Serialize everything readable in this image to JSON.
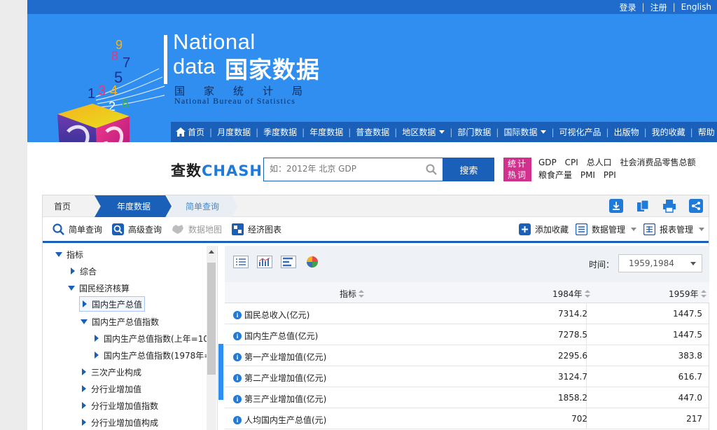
{
  "topbar": {
    "login": "登录",
    "register": "注册",
    "english": "English"
  },
  "logo": {
    "en_line1": "National",
    "en_line2": "data",
    "cn": "国家数据",
    "bureau_cn": "国家统计局",
    "bureau_en": "National Bureau of Statistics",
    "cube_digits": [
      "9",
      "8",
      "7",
      "5",
      "1",
      "3",
      "4",
      "2",
      "6"
    ]
  },
  "nav": {
    "items": [
      "首页",
      "月度数据",
      "季度数据",
      "年度数据",
      "普查数据",
      "地区数据",
      "部门数据",
      "国际数据",
      "可视化产品",
      "出版物",
      "我的收藏",
      "帮助"
    ],
    "dropdown_items": [
      "地区数据",
      "国际数据"
    ]
  },
  "search": {
    "brand_cn": "查数",
    "brand_en": "CHASHU",
    "placeholder": "如：2012年 北京 GDP",
    "button": "搜索",
    "hot_tag_line1": "统计",
    "hot_tag_line2": "热词",
    "hot_words": [
      "GDP",
      "CPI",
      "总人口",
      "社会消费品零售总额",
      "粮食产量",
      "PMI",
      "PPI"
    ]
  },
  "breadcrumb": {
    "home": "首页",
    "year": "年度数据",
    "simple": "简单查询"
  },
  "toolbar": {
    "simple_query": "简单查询",
    "advanced_query": "高级查询",
    "data_map": "数据地图",
    "econ_chart": "经济图表",
    "add_favorite": "添加收藏",
    "data_manage": "数据管理",
    "report_manage": "报表管理"
  },
  "tree": {
    "root": "指标",
    "items": [
      {
        "label": "综合",
        "level": 1,
        "expanded": false
      },
      {
        "label": "国民经济核算",
        "level": 1,
        "expanded": true
      },
      {
        "label": "国内生产总值",
        "level": 2,
        "expanded": false,
        "selected": true
      },
      {
        "label": "国内生产总值指数",
        "level": 2,
        "expanded": true
      },
      {
        "label": "国内生产总值指数(上年=10",
        "level": 3,
        "expanded": false
      },
      {
        "label": "国内生产总值指数(1978年=",
        "level": 3,
        "expanded": false
      },
      {
        "label": "三次产业构成",
        "level": 2,
        "expanded": false
      },
      {
        "label": "分行业增加值",
        "level": 2,
        "expanded": false
      },
      {
        "label": "分行业增加值指数",
        "level": 2,
        "expanded": false
      },
      {
        "label": "分行业增加值构成",
        "level": 2,
        "expanded": false
      }
    ]
  },
  "data_panel": {
    "time_label": "时间：",
    "time_value": "1959,1984",
    "header": {
      "indicator": "指标",
      "col1": "1984年",
      "col2": "1959年"
    },
    "rows": [
      {
        "name": "国民总收入(亿元)",
        "v1984": "7314.2",
        "v1959": "1447.5"
      },
      {
        "name": "国内生产总值(亿元)",
        "v1984": "7278.5",
        "v1959": "1447.5"
      },
      {
        "name": "第一产业增加值(亿元)",
        "v1984": "2295.6",
        "v1959": "383.8"
      },
      {
        "name": "第二产业增加值(亿元)",
        "v1984": "3124.7",
        "v1959": "616.7"
      },
      {
        "name": "第三产业增加值(亿元)",
        "v1984": "1858.2",
        "v1959": "447.0"
      },
      {
        "name": "人均国内生产总值(元)",
        "v1984": "702",
        "v1959": "217"
      }
    ]
  },
  "colors": {
    "brand_blue": "#1a5fb8",
    "header_blue": "#2f8ef0",
    "hot_pink": "#d1308d"
  }
}
